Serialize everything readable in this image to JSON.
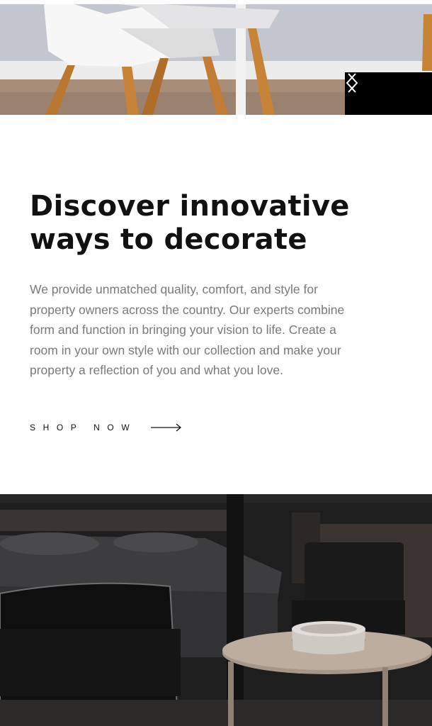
{
  "hero": {
    "image": "white-chair-on-wood-floor",
    "prev_icon": "chevron-left-icon",
    "next_icon": "chevron-right-icon"
  },
  "headline": {
    "line1": "Discover innovative",
    "line2": "ways to decorate"
  },
  "description": {
    "lines": [
      "We provide unmatched quality, comfort, and style for",
      "property owners across the country. Our experts combine",
      "form and function in bringing your vision to life. Create a",
      "room in your own style with our collection and make your",
      "property a reflection of you and what you love."
    ]
  },
  "cta": {
    "label": "SHOP NOW",
    "icon": "arrow-right-icon"
  },
  "bottom_image": "dark-bedroom-with-armchairs-and-coffee-table",
  "colors": {
    "text_dark": "#111111",
    "text_muted": "#7a7a7a",
    "control_bg": "#000000"
  }
}
